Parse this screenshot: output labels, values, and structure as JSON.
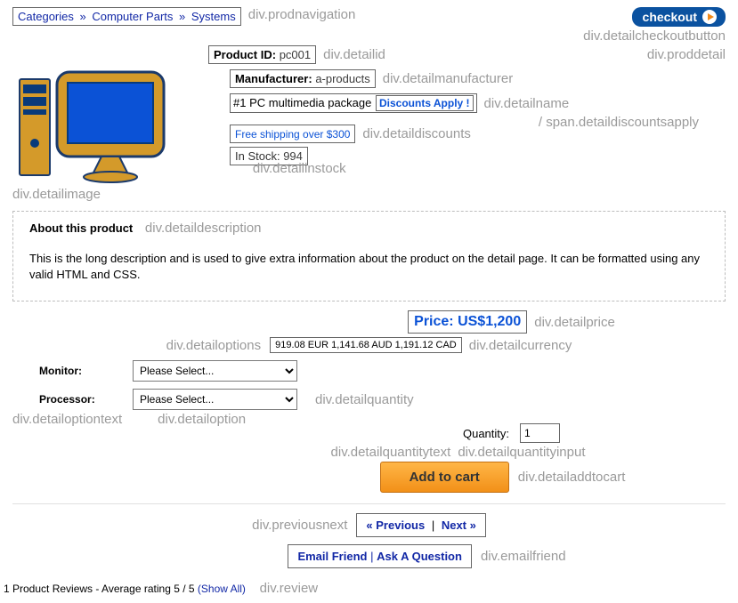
{
  "breadcrumb": {
    "c1": "Categories",
    "c2": "Computer Parts",
    "c3": "Systems"
  },
  "annots": {
    "prodnavigation": "div.prodnavigation",
    "detailid": "div.detailid",
    "detailcheckoutbutton": "div.detailcheckoutbutton",
    "proddetail": "div.proddetail",
    "detailmanufacturer": "div.detailmanufacturer",
    "detailname": "div.detailname",
    "detaildiscountsapply": "/ span.detaildiscountsapply",
    "detaildiscounts": "div.detaildiscounts",
    "detailinstock": "div.detailinstock",
    "detailimage": "div.detailimage",
    "detaildescription": "div.detaildescription",
    "detailprice": "div.detailprice",
    "detailoptions": "div.detailoptions",
    "detailcurrency": "div.detailcurrency",
    "detailoptiontext": "div.detailoptiontext",
    "detailoption": "div.detailoption",
    "detailquantity": "div.detailquantity",
    "detailquantitytext": "div.detailquantitytext",
    "detailquantityinput": "div.detailquantityinput",
    "detailaddtocart": "div.detailaddtocart",
    "previousnext": "div.previousnext",
    "emailfriend": "div.emailfriend",
    "review": "div.review"
  },
  "checkout": {
    "label": "checkout"
  },
  "product": {
    "id_label": "Product ID:",
    "id_value": "pc001",
    "manu_label": "Manufacturer:",
    "manu_value": "a-products",
    "name": "#1 PC multimedia package",
    "discounts_apply": "Discounts Apply !",
    "discount_text": "Free shipping over $300",
    "instock_label": "In Stock:",
    "instock_value": "994"
  },
  "description": {
    "heading": "About this product",
    "body": "This is the long description and is used to give extra information about the product on the detail page. It can be formatted using any valid HTML and CSS."
  },
  "price": {
    "label": "Price:",
    "value": "US$1,200"
  },
  "currency": {
    "text": "919.08 EUR 1,141.68 AUD 1,191.12 CAD"
  },
  "options": {
    "monitor_label": "Monitor:",
    "processor_label": "Processor:",
    "placeholder": "Please Select..."
  },
  "quantity": {
    "label": "Quantity:",
    "value": "1"
  },
  "addcart": {
    "label": "Add to cart"
  },
  "prevnext": {
    "prev": "« Previous",
    "next": "Next »"
  },
  "email": {
    "friend": "Email Friend",
    "ask": "Ask A Question"
  },
  "review": {
    "text": "1 Product Reviews - Average rating 5 / 5 ",
    "showall": "(Show All)"
  }
}
